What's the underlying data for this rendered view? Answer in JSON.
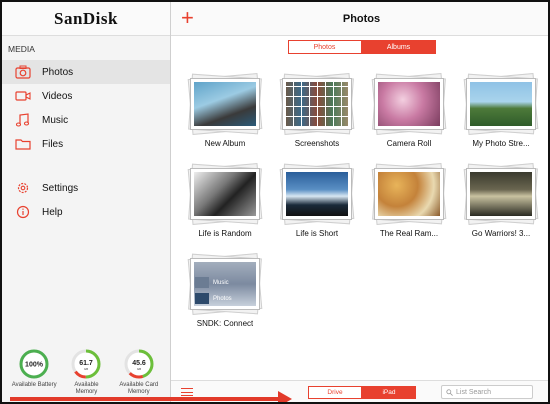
{
  "brand": {
    "name": "SanDisk"
  },
  "sidebar": {
    "section_label": "MEDIA",
    "items": [
      {
        "label": "Photos",
        "icon": "camera-icon",
        "active": true
      },
      {
        "label": "Videos",
        "icon": "video-icon",
        "active": false
      },
      {
        "label": "Music",
        "icon": "music-icon",
        "active": false
      },
      {
        "label": "Files",
        "icon": "folder-icon",
        "active": false
      }
    ],
    "settings_items": [
      {
        "label": "Settings",
        "icon": "gear-icon"
      },
      {
        "label": "Help",
        "icon": "info-icon"
      }
    ],
    "gauges": [
      {
        "value": "100%",
        "caption": "Available Battery",
        "level": 1.0
      },
      {
        "value": "61.7",
        "unit": "GB",
        "caption": "Available Memory",
        "level": 0.5
      },
      {
        "value": "45.6",
        "unit": "GB",
        "caption": "Available Card Memory",
        "level": 0.45
      }
    ]
  },
  "header": {
    "add_label": "+",
    "title": "Photos",
    "tabs": [
      {
        "label": "Photos",
        "selected": false
      },
      {
        "label": "Albums",
        "selected": true
      }
    ]
  },
  "albums": [
    {
      "name": "New Album"
    },
    {
      "name": "Screenshots"
    },
    {
      "name": "Camera Roll"
    },
    {
      "name": "My Photo Stre..."
    },
    {
      "name": "Life is Random"
    },
    {
      "name": "Life is Short"
    },
    {
      "name": "The Real Ram..."
    },
    {
      "name": "Go Warriors! 3..."
    },
    {
      "name": "SNDK: Connect",
      "inner_labels": [
        "Music",
        "Photos"
      ]
    }
  ],
  "bottombar": {
    "source_tabs": [
      {
        "label": "Drive",
        "selected": false
      },
      {
        "label": "iPad",
        "selected": true
      }
    ],
    "search_placeholder": "List Search"
  },
  "colors": {
    "accent": "#e8412f",
    "annotation_arrow": "#e23a2a"
  }
}
